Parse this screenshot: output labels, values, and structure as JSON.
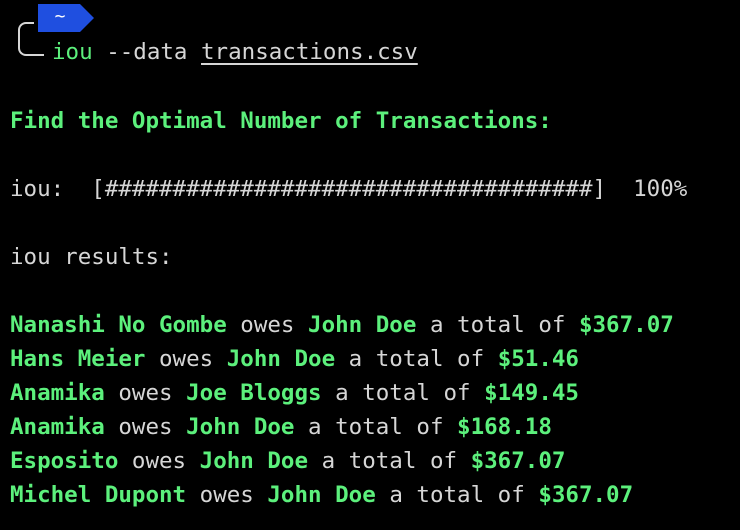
{
  "prompt": {
    "dir": "~",
    "command": "iou",
    "flag": "--data",
    "file": "transactions.csv"
  },
  "heading": "Find the Optimal Number of Transactions:",
  "progress": {
    "label": "iou:",
    "bar": "[####################################]",
    "percent": "100%",
    "value": 1.0
  },
  "results_label": "iou results:",
  "connectors": {
    "owes": "owes",
    "a_total_of": "a total of"
  },
  "results": [
    {
      "debtor": "Nanashi No Gombe",
      "creditor": "John Doe",
      "amount": "$367.07"
    },
    {
      "debtor": "Hans Meier",
      "creditor": "John Doe",
      "amount": "$51.46"
    },
    {
      "debtor": "Anamika",
      "creditor": "Joe Bloggs",
      "amount": "$149.45"
    },
    {
      "debtor": "Anamika",
      "creditor": "John Doe",
      "amount": "$168.18"
    },
    {
      "debtor": "Esposito",
      "creditor": "John Doe",
      "amount": "$367.07"
    },
    {
      "debtor": "Michel Dupont",
      "creditor": "John Doe",
      "amount": "$367.07"
    }
  ],
  "colors": {
    "background": "#000000",
    "accent_green": "#5cf07c",
    "text": "#d6d6d6",
    "badge": "#1f4fe0"
  }
}
